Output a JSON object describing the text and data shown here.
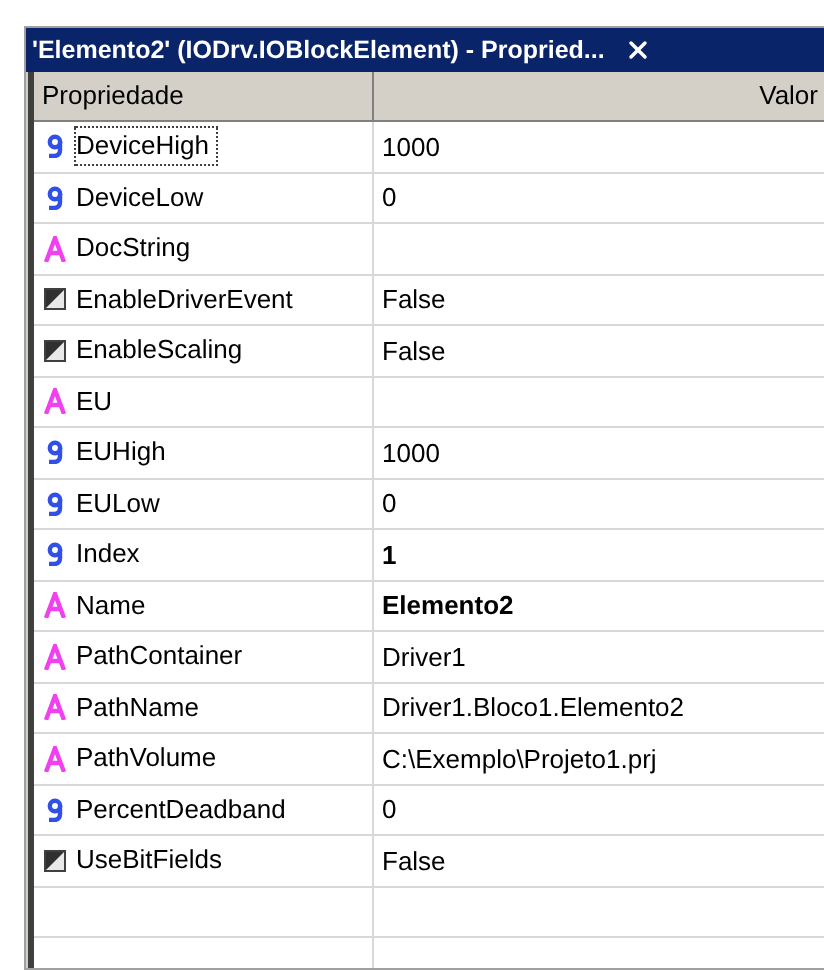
{
  "window": {
    "title": "'Elemento2' (IODrv.IOBlockElement) - Propried..."
  },
  "columns": [
    "Propriedade",
    "Valor"
  ],
  "rows": [
    {
      "kind": "number",
      "name": "DeviceHigh",
      "value": "1000",
      "focused": true
    },
    {
      "kind": "number",
      "name": "DeviceLow",
      "value": "0",
      "focused": false
    },
    {
      "kind": "text",
      "name": "DocString",
      "focused": false
    },
    {
      "kind": "bool",
      "name": "EnableDriverEvent",
      "value": "False",
      "focused": false
    },
    {
      "kind": "bool",
      "name": "EnableScaling",
      "value": "False",
      "focused": false
    },
    {
      "kind": "text",
      "name": "EU",
      "focused": false
    },
    {
      "kind": "number",
      "name": "EUHigh",
      "value": "1000",
      "focused": false
    },
    {
      "kind": "number",
      "name": "EULow",
      "value": "0",
      "focused": false
    },
    {
      "kind": "number",
      "name": "Index",
      "value": "1",
      "bold": true,
      "focused": false
    },
    {
      "kind": "text",
      "name": "Name",
      "value": "Elemento2",
      "bold": true,
      "focused": false
    },
    {
      "kind": "text",
      "name": "PathContainer",
      "value": "Driver1",
      "focused": false
    },
    {
      "kind": "text",
      "name": "PathName",
      "value": "Driver1.Bloco1.Elemento2",
      "focused": false
    },
    {
      "kind": "text",
      "name": "PathVolume",
      "value": "C:\\Exemplo\\Projeto1.prj",
      "focused": false
    },
    {
      "kind": "number",
      "name": "PercentDeadband",
      "value": "0",
      "focused": false
    },
    {
      "kind": "bool",
      "name": "UseBitFields",
      "value": "False",
      "focused": false
    }
  ]
}
